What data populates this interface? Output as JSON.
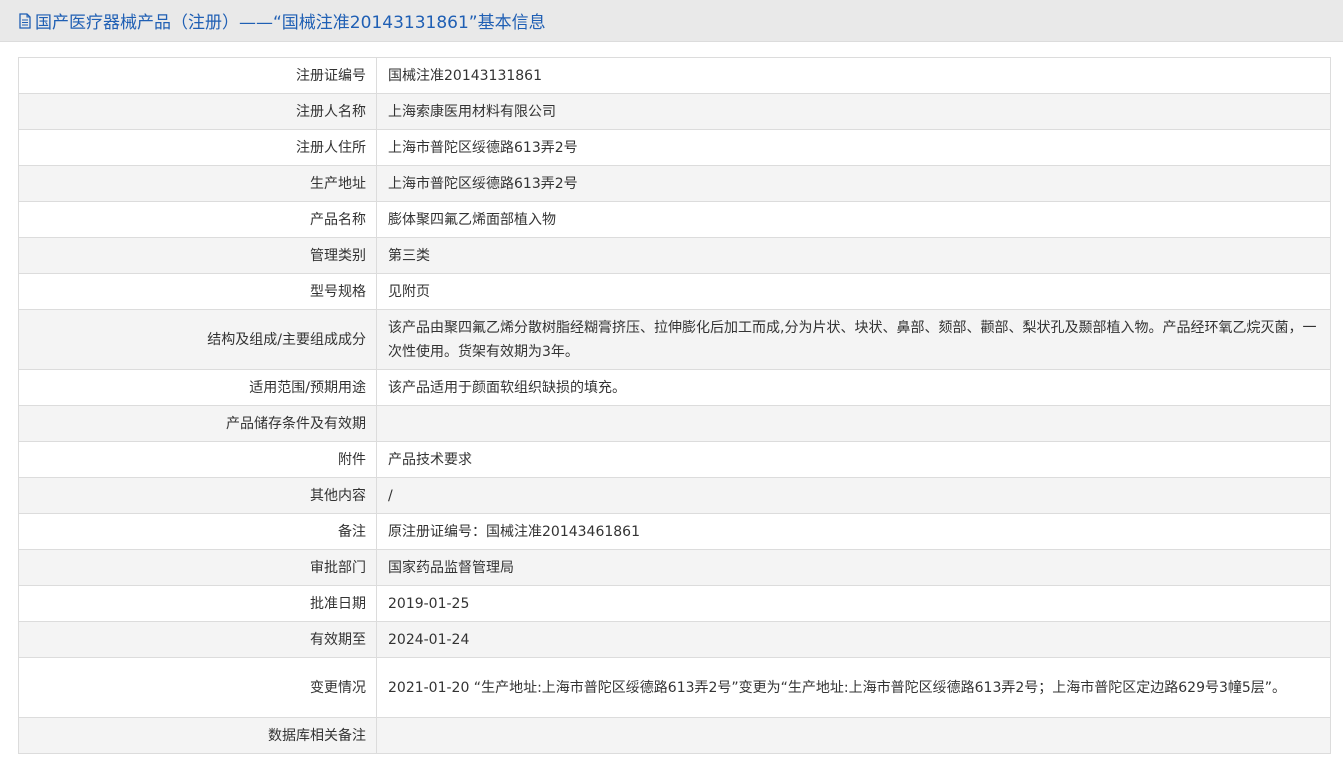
{
  "header": {
    "title": "国产医疗器械产品（注册）——“国械注准20143131861”基本信息",
    "icon": "document-icon"
  },
  "rows": [
    {
      "label": "注册证编号",
      "value": "国械注准20143131861"
    },
    {
      "label": "注册人名称",
      "value": "上海索康医用材料有限公司"
    },
    {
      "label": "注册人住所",
      "value": "上海市普陀区绥德路613弄2号"
    },
    {
      "label": "生产地址",
      "value": "上海市普陀区绥德路613弄2号"
    },
    {
      "label": "产品名称",
      "value": "膨体聚四氟乙烯面部植入物"
    },
    {
      "label": "管理类别",
      "value": "第三类"
    },
    {
      "label": "型号规格",
      "value": "见附页"
    },
    {
      "label": "结构及组成/主要组成成分",
      "value": "该产品由聚四氟乙烯分散树脂经糊膏挤压、拉伸膨化后加工而成,分为片状、块状、鼻部、颏部、颧部、梨状孔及颞部植入物。产品经环氧乙烷灭菌，一次性使用。货架有效期为3年。"
    },
    {
      "label": "适用范围/预期用途",
      "value": "该产品适用于颜面软组织缺损的填充。"
    },
    {
      "label": "产品储存条件及有效期",
      "value": ""
    },
    {
      "label": "附件",
      "value": "产品技术要求"
    },
    {
      "label": "其他内容",
      "value": "/"
    },
    {
      "label": "备注",
      "value": "原注册证编号：国械注准20143461861"
    },
    {
      "label": "审批部门",
      "value": "国家药品监督管理局"
    },
    {
      "label": "批准日期",
      "value": "2019-01-25"
    },
    {
      "label": "有效期至",
      "value": "2024-01-24"
    },
    {
      "label": "变更情况",
      "value": "2021-01-20 “生产地址:上海市普陀区绥德路613弄2号”变更为“生产地址:上海市普陀区绥德路613弄2号；上海市普陀区定边路629号3幢5层”。"
    },
    {
      "label": "数据库相关备注",
      "value": ""
    }
  ]
}
